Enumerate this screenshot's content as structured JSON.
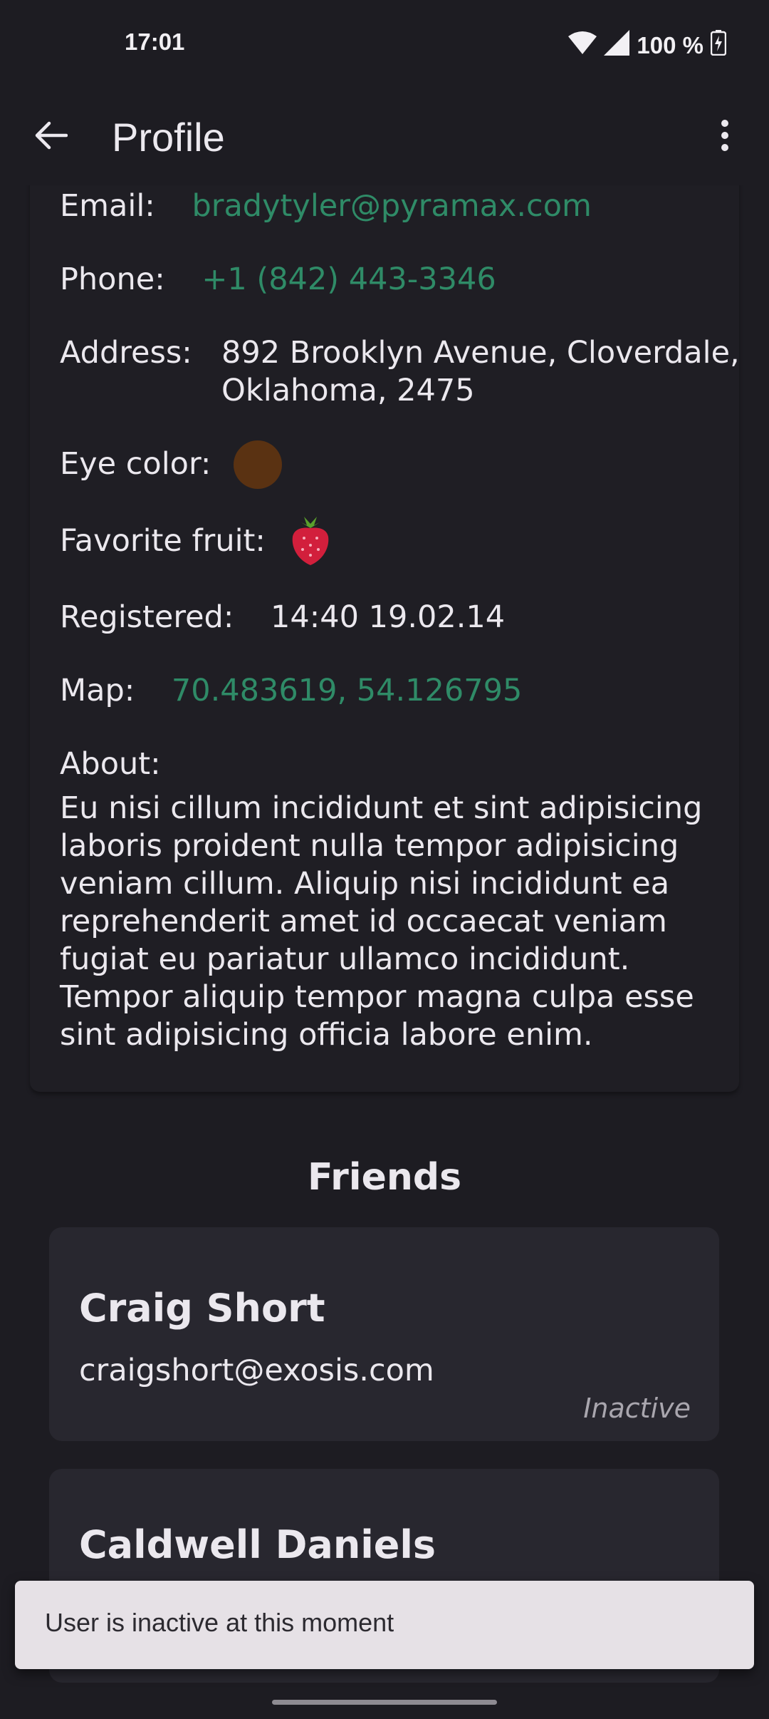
{
  "status_bar": {
    "time": "17:01",
    "battery": "100 %",
    "icons": [
      "wifi-icon",
      "signal-icon",
      "battery-charging-icon"
    ]
  },
  "app_bar": {
    "title": "Profile",
    "back_icon": "arrow-back-icon",
    "menu_icon": "more-vert-icon"
  },
  "details": {
    "email_label": "Email:",
    "email": "bradytyler@pyramax.com",
    "phone_label": "Phone:",
    "phone": "+1 (842) 443-3346",
    "address_label": "Address:",
    "address_line1": "892 Brooklyn Avenue, Cloverdale,",
    "address_line2": "Oklahoma, 2475",
    "eye_color_label": "Eye color:",
    "eye_color_value": "#5a3212",
    "favorite_fruit_label": "Favorite fruit:",
    "favorite_fruit_icon": "strawberry-icon",
    "registered_label": "Registered:",
    "registered": "14:40 19.02.14",
    "map_label": "Map:",
    "map_coords": "70.483619, 54.126795",
    "about_label": "About:",
    "about": "Eu nisi cillum incididunt et sint adipisicing laboris proident nulla tempor adipisicing veniam cillum. Aliquip nisi incididunt ea reprehenderit amet id occaecat veniam fugiat eu pariatur ullamco incididunt. Tempor aliquip tempor magna culpa esse sint adipisicing officia labore enim."
  },
  "friends": {
    "title": "Friends",
    "items": [
      {
        "name": "Craig Short",
        "email": "craigshort@exosis.com",
        "status": "Inactive"
      },
      {
        "name": "Caldwell Daniels"
      }
    ]
  },
  "snackbar": {
    "message": "User is inactive at this moment"
  },
  "colors": {
    "background": "#1d1c22",
    "link": "#2f8b67",
    "card": "#28272f",
    "snackbar": "#e6e1e6"
  }
}
